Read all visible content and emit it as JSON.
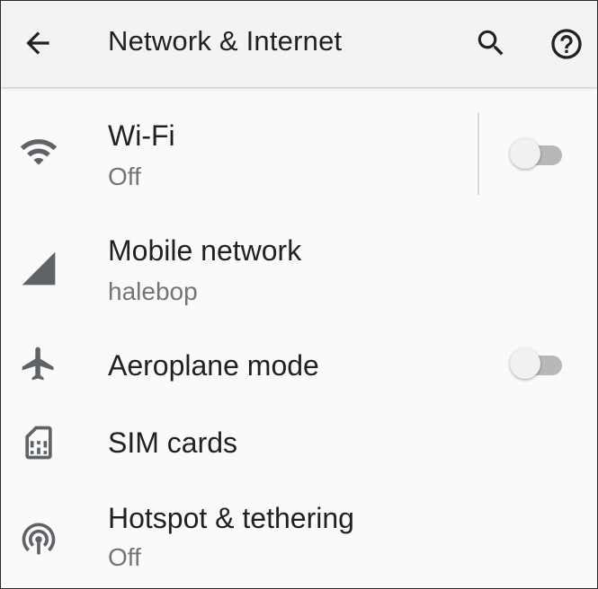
{
  "header": {
    "title": "Network & Internet",
    "icons": [
      "arrow-back-icon",
      "search-icon",
      "help-icon"
    ]
  },
  "items": [
    {
      "title": "Wi-Fi",
      "summary": "Off",
      "icon": "wifi-icon",
      "toggle": "off"
    },
    {
      "title": "Mobile network",
      "summary": "halebop",
      "icon": "cellular-signal-icon"
    },
    {
      "title": "Aeroplane mode",
      "icon": "airplane-icon",
      "toggle": "off"
    },
    {
      "title": "SIM cards",
      "icon": "sim-card-icon"
    },
    {
      "title": "Hotspot & tethering",
      "summary": "Off",
      "icon": "hotspot-icon"
    }
  ],
  "colors": {
    "icon": "#5f6368",
    "title_text": "#202124",
    "summary_text": "#757575",
    "appbar_bg": "#f3f3f3",
    "page_bg": "#fafafa"
  }
}
